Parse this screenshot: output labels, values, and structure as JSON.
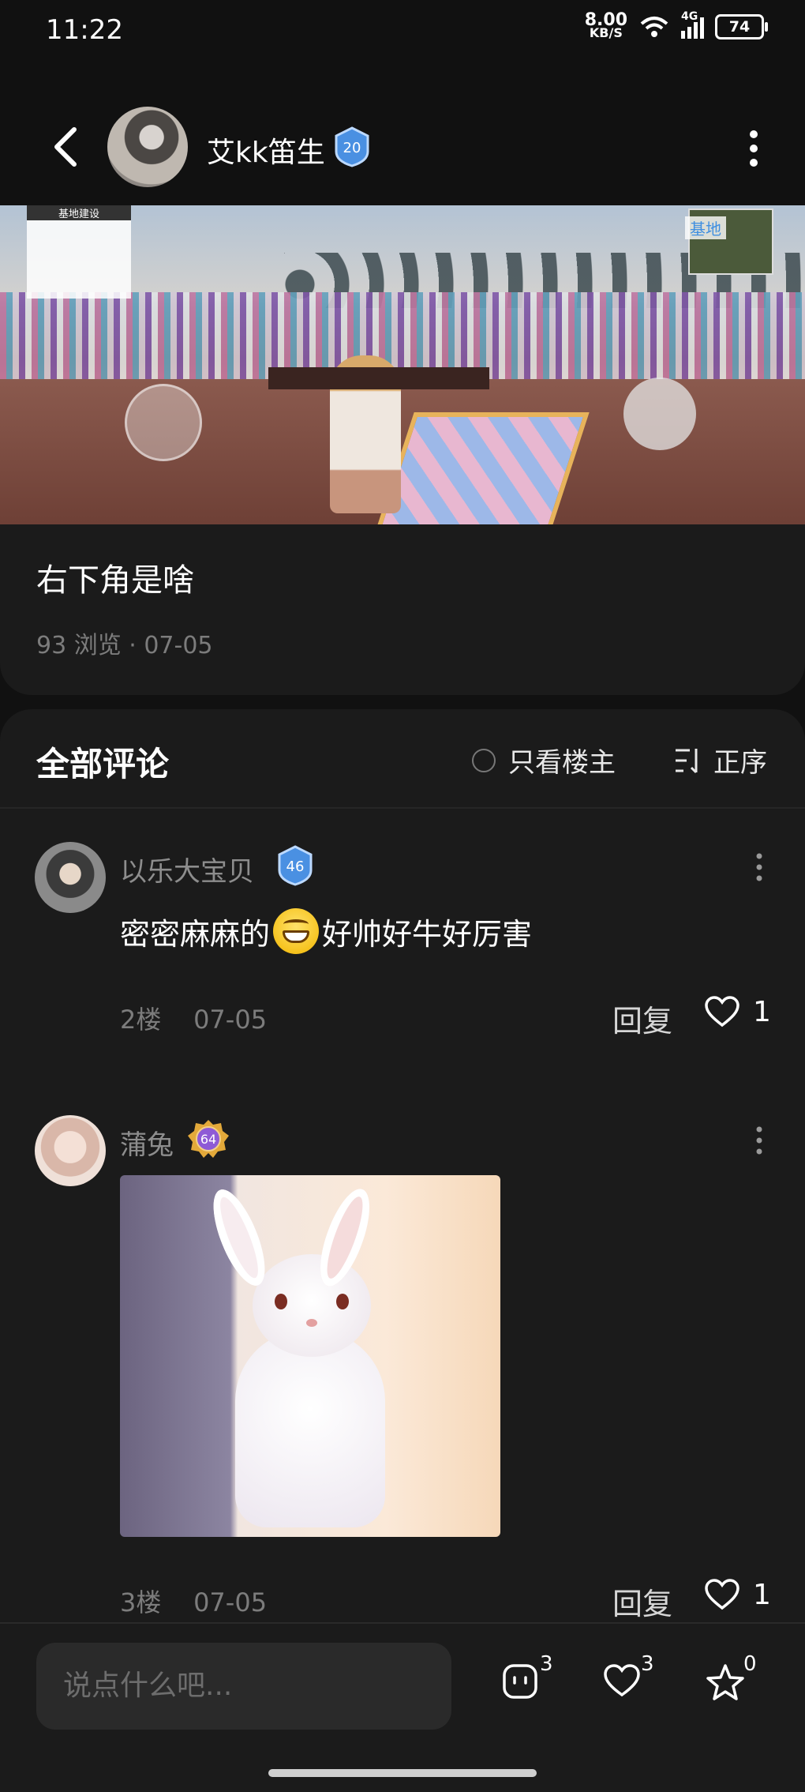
{
  "status_bar": {
    "time": "11:22",
    "net_speed": "8.00",
    "net_unit": "KB/S",
    "network": "4G",
    "battery": "74"
  },
  "header": {
    "author": "艾kk笛生",
    "level": "20"
  },
  "post": {
    "title": "右下角是啥",
    "meta": "93 浏览 · 07-05",
    "image_labels": {
      "top_left": "基地建设",
      "top_right": "基地"
    }
  },
  "comments_section": {
    "title": "全部评论",
    "only_op": "只看楼主",
    "sort": "正序",
    "items": [
      {
        "user": "以乐大宝贝",
        "level": "46",
        "text_before": "密密麻麻的",
        "text_after": "好帅好牛好厉害",
        "floor": "2楼",
        "date": "07-05",
        "reply": "回复",
        "likes": "1"
      },
      {
        "user": "蒲兔",
        "level": "64",
        "floor": "3楼",
        "date": "07-05",
        "reply": "回复",
        "likes": "1"
      }
    ]
  },
  "bottom_bar": {
    "placeholder": "说点什么吧...",
    "comments_count": "3",
    "likes_count": "3",
    "favorites_count": "0"
  },
  "colors": {
    "background": "#111111",
    "card": "#1b1b1b",
    "badge_blue": "#4a90e2",
    "badge_purple": "#8e5ad6"
  }
}
